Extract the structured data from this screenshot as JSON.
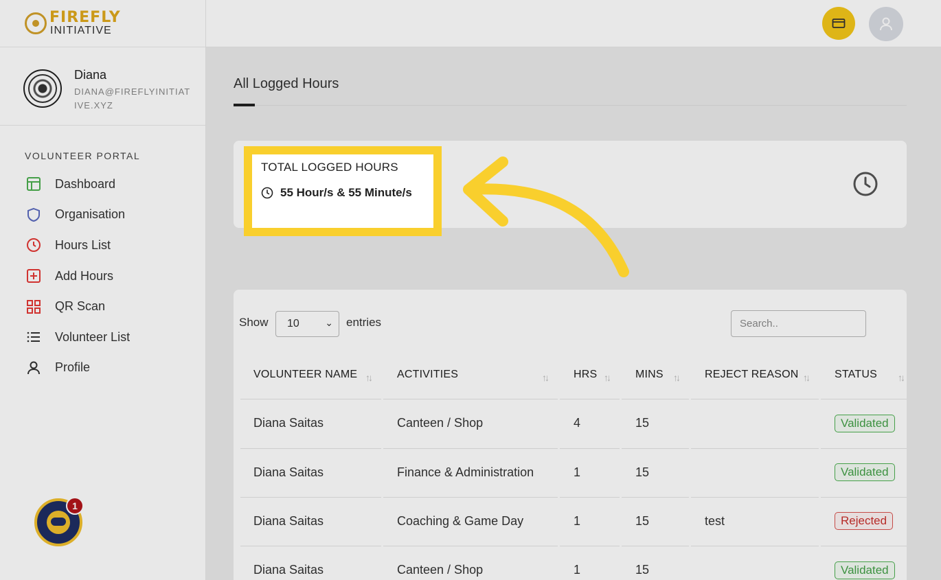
{
  "brand": {
    "line1": "FIREFLY",
    "line2": "INITIATIVE"
  },
  "user": {
    "name": "Diana",
    "email": "DIANA@FIREFLYINITIATIVE.XYZ"
  },
  "sidebar": {
    "section_title": "VOLUNTEER PORTAL",
    "items": [
      {
        "label": "Dashboard",
        "icon": "layout-icon",
        "color": "#4caf50"
      },
      {
        "label": "Organisation",
        "icon": "shield-icon",
        "color": "#5c6bc0"
      },
      {
        "label": "Hours List",
        "icon": "clock-icon",
        "color": "#e53935"
      },
      {
        "label": "Add Hours",
        "icon": "plus-square-icon",
        "color": "#e53935"
      },
      {
        "label": "QR Scan",
        "icon": "grid-icon",
        "color": "#e53935"
      },
      {
        "label": "Volunteer List",
        "icon": "list-icon",
        "color": "#333333"
      },
      {
        "label": "Profile",
        "icon": "user-icon",
        "color": "#333333"
      }
    ]
  },
  "chatbot": {
    "badge_count": "1"
  },
  "page": {
    "title": "All Logged Hours"
  },
  "stat": {
    "title": "TOTAL LOGGED HOURS",
    "value": "55 Hour/s & 55 Minute/s"
  },
  "table": {
    "show_label": "Show",
    "entries_value": "10",
    "entries_label": "entries",
    "search_placeholder": "Search..",
    "columns": [
      "VOLUNTEER NAME",
      "ACTIVITIES",
      "HRS",
      "MINS",
      "REJECT REASON",
      "STATUS"
    ],
    "rows": [
      {
        "name": "Diana Saitas",
        "activity": "Canteen / Shop",
        "hrs": "4",
        "mins": "15",
        "reason": "",
        "status": "Validated"
      },
      {
        "name": "Diana Saitas",
        "activity": "Finance & Administration",
        "hrs": "1",
        "mins": "15",
        "reason": "",
        "status": "Validated"
      },
      {
        "name": "Diana Saitas",
        "activity": "Coaching & Game Day",
        "hrs": "1",
        "mins": "15",
        "reason": "test",
        "status": "Rejected"
      },
      {
        "name": "Diana Saitas",
        "activity": "Canteen / Shop",
        "hrs": "1",
        "mins": "15",
        "reason": "",
        "status": "Validated"
      }
    ]
  },
  "colors": {
    "accent": "#f9cf2d",
    "validated": "#43a047",
    "rejected": "#c9302c"
  }
}
